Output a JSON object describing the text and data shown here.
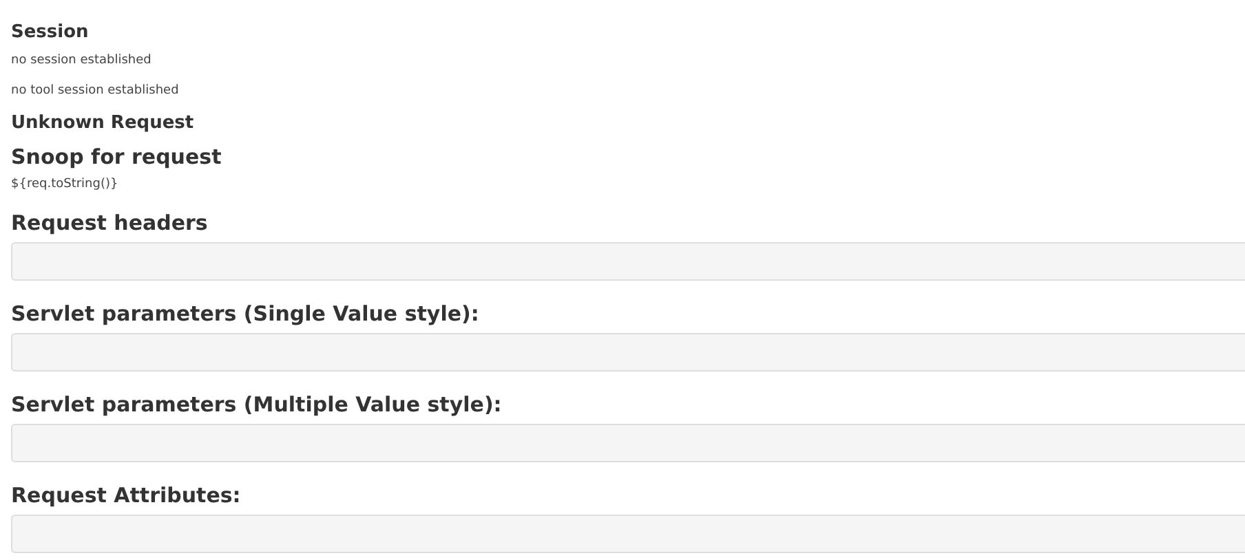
{
  "session": {
    "heading": "Session",
    "lines": [
      "no session established",
      "no tool session established"
    ]
  },
  "unknown_heading": "Unknown Request",
  "snoop": {
    "heading": "Snoop for request",
    "text": "${req.toString()}"
  },
  "sections": [
    {
      "heading": "Request headers"
    },
    {
      "heading": "Servlet parameters (Single Value style):"
    },
    {
      "heading": "Servlet parameters (Multiple Value style):"
    },
    {
      "heading": "Request Attributes:"
    }
  ]
}
